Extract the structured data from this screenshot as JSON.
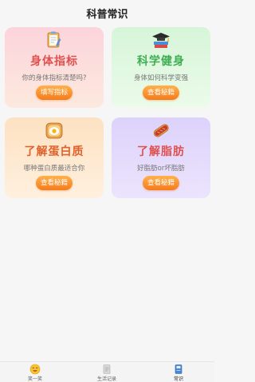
{
  "header": {
    "title": "科普常识"
  },
  "cards": [
    {
      "title": "身体指标",
      "desc": "你的身体指标清楚吗?",
      "button": "填写指标",
      "icon": "clipboard-icon"
    },
    {
      "title": "科学健身",
      "desc": "身体如何科学变强",
      "button": "查看秘籍",
      "icon": "graduation-cap-books-icon"
    },
    {
      "title": "了解蛋白质",
      "desc": "哪种蛋白质最适合你",
      "button": "查看秘籍",
      "icon": "egg-toast-icon"
    },
    {
      "title": "了解脂肪",
      "desc": "好脂肪or坏脂肪",
      "button": "查看秘籍",
      "icon": "sausage-bread-icon"
    }
  ],
  "tabbar": {
    "items": [
      {
        "label": "笑一笑",
        "icon": "smiley-icon",
        "active": false
      },
      {
        "label": "生活记录",
        "icon": "notebook-icon",
        "active": false
      },
      {
        "label": "常识",
        "icon": "book-icon",
        "active": true
      }
    ]
  }
}
